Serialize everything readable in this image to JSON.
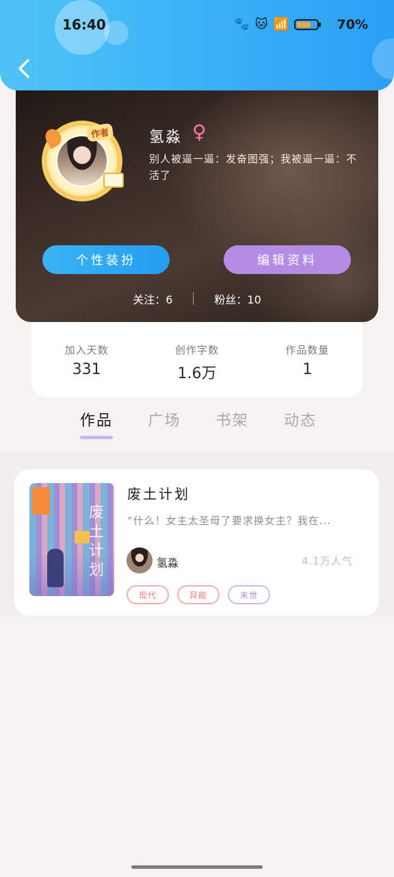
{
  "status_bar": {
    "time": "16:40",
    "battery": "70%"
  },
  "profile": {
    "author_badge": "作者",
    "username": "氢淼",
    "gender_symbol": "♀",
    "signature": "别人被逼一逼：发奋图强；我被逼一逼：不活了",
    "buttons": {
      "decor": "个性装扮",
      "edit": "编辑资料"
    },
    "follow": "关注：6",
    "fans": "粉丝：10"
  },
  "stats": [
    {
      "label": "加入天数",
      "value": "331"
    },
    {
      "label": "创作字数",
      "value": "1.6万"
    },
    {
      "label": "作品数量",
      "value": "1"
    }
  ],
  "tabs": [
    {
      "label": "作品",
      "active": true
    },
    {
      "label": "广场",
      "active": false
    },
    {
      "label": "书架",
      "active": false
    },
    {
      "label": "动态",
      "active": false
    }
  ],
  "work": {
    "title": "废土计划",
    "cover_title": "废土计划",
    "summary": "“什么！女主太圣母了要求换女主？我在...",
    "author": "氢淼",
    "popularity": "4.1万人气",
    "tags": [
      "现代",
      "异能",
      "末世"
    ]
  },
  "colors": {
    "header_blue": "#2a9ff6",
    "button_blue": "#239ef0",
    "button_purple": "#b48ce6",
    "tab_underline": "#cdb6ef",
    "gender_pink": "#ff7aa2"
  }
}
